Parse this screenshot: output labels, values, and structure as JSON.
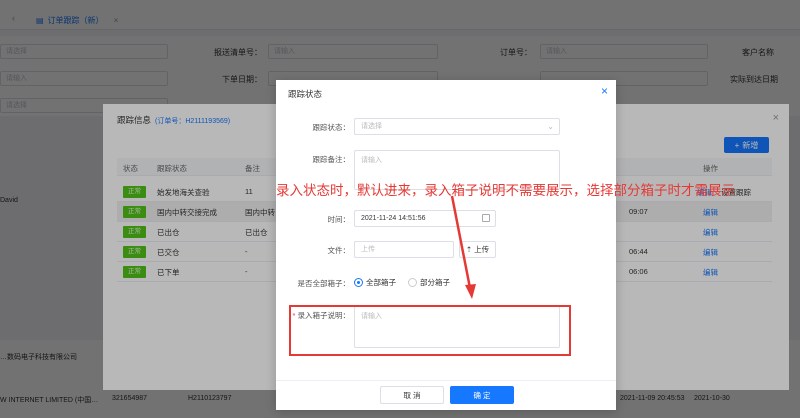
{
  "tabs": {
    "active_label": "订单跟踪（新）"
  },
  "filters": {
    "declaration_no_label": "报送清单号：",
    "order_no_label": "订单号：",
    "order_date_label": "下单日期：",
    "placeholder_select": "请选择",
    "placeholder_input": "请输入",
    "right_label_1": "客户名称",
    "right_label_2": "实际到达日期"
  },
  "info_dialog": {
    "title": "跟踪信息",
    "order_ref": "(订单号：H2111193569)",
    "add_button": "新增",
    "headers": [
      "状态",
      "跟踪状态",
      "备注",
      "操作"
    ],
    "rows": [
      {
        "status": "正常",
        "tracking": "始发地海关查验",
        "remark": "11",
        "time": "",
        "action": "编辑",
        "action2": "设置跟踪"
      },
      {
        "status": "正常",
        "tracking": "国内中转交接完成",
        "remark": "国内中转",
        "time": "09:07",
        "action": "编辑",
        "action2": ""
      },
      {
        "status": "正常",
        "tracking": "已出仓",
        "remark": "已出仓",
        "time": "",
        "action": "编辑",
        "action2": ""
      },
      {
        "status": "正常",
        "tracking": "已交仓",
        "remark": "-",
        "time": "06:44",
        "action": "编辑",
        "action2": ""
      },
      {
        "status": "正常",
        "tracking": "已下单",
        "remark": "-",
        "time": "06:06",
        "action": "编辑",
        "action2": ""
      }
    ]
  },
  "background_table": {
    "left_text_1": "David",
    "company_1": "…数码电子科技有限公司",
    "company_2": "W INTERNET LIMITED (中国…",
    "cell_1": "321654987",
    "cell_2": "H2110123797",
    "cell_3": "2021-11-09 20:45:53",
    "cell_4": "2021-10-30"
  },
  "status_dialog": {
    "title": "跟踪状态",
    "tracking_status_label": "跟踪状态：",
    "tracking_status_placeholder": "请选择",
    "tracking_remark_label": "跟踪备注：",
    "tracking_remark_placeholder": "请输入",
    "time_label": "时间：",
    "time_value": "2021-11-24 14:51:56",
    "file_label": "文件：",
    "file_placeholder": "上传",
    "upload_button": "上传",
    "all_boxes_label": "是否全部箱子：",
    "radio_all": "全部箱子",
    "radio_partial": "部分箱子",
    "box_note_label": "录入箱子说明：",
    "box_note_placeholder": "请输入",
    "cancel_button": "取 消",
    "ok_button": "确 定"
  },
  "annotation": {
    "text": "录入状态时，默认进来，录入箱子说明不需要展示，选择部分箱子时才需展示"
  },
  "colors": {
    "primary": "#1677ff",
    "annotation_red": "#e53935",
    "status_green": "#52c41a"
  }
}
